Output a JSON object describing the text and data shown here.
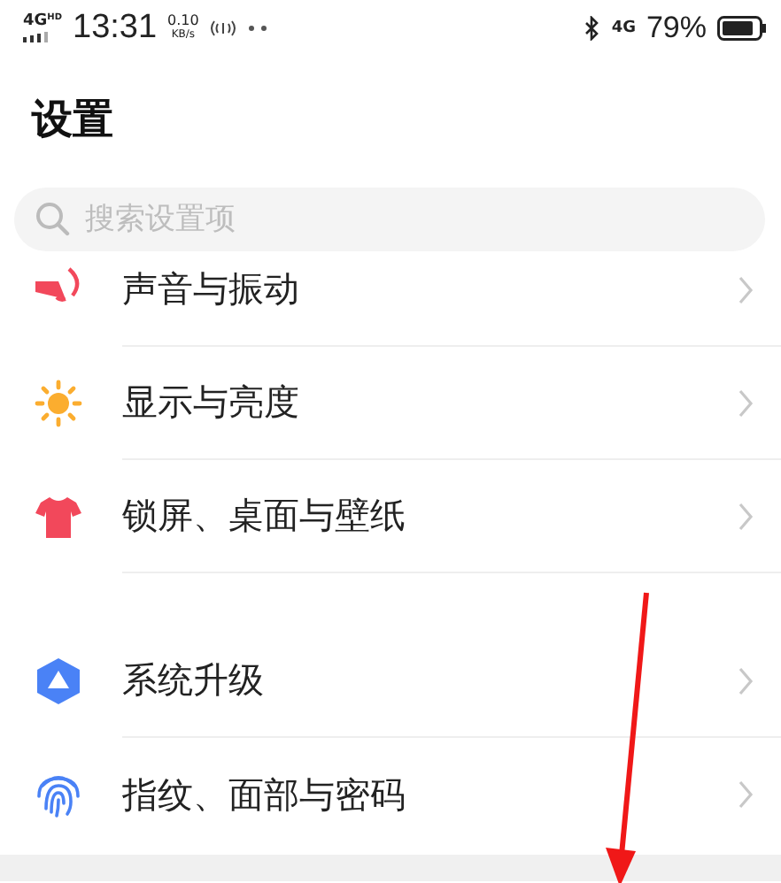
{
  "status_bar": {
    "network": "4G",
    "network_badge": "HD",
    "time": "13:31",
    "speed": "0.10",
    "speed_unit": "KB/s",
    "network_right": "4G",
    "battery": "79%"
  },
  "title": "设置",
  "search": {
    "placeholder": "搜索设置项"
  },
  "sections": [
    {
      "items": [
        {
          "label": "声音与振动"
        },
        {
          "label": "显示与亮度"
        },
        {
          "label": "锁屏、桌面与壁纸"
        }
      ]
    },
    {
      "items": [
        {
          "label": "系统升级"
        },
        {
          "label": "指纹、面部与密码"
        }
      ]
    }
  ]
}
